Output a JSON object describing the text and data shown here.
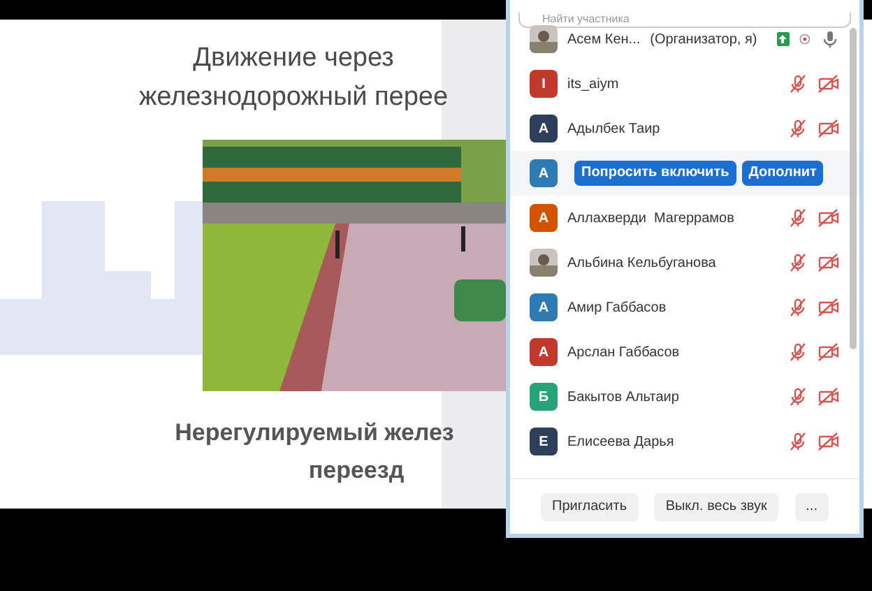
{
  "slide": {
    "title_lines": [
      "Движение через",
      "железнодорожный перее"
    ],
    "caption_lines": [
      "Нерегулируемый желез",
      "переезд"
    ]
  },
  "participants_panel": {
    "search": {
      "placeholder": "Найти участника"
    },
    "participants": [
      {
        "name": "Асем Кен...",
        "role": "(Организатор, я)",
        "sharing": true,
        "recording": true,
        "muted": false
      },
      {
        "kind": "letter",
        "initial": "I",
        "color": "#c0392b",
        "name": "its_aiym",
        "muted": true,
        "video_off": true
      },
      {
        "kind": "letter",
        "initial": "A",
        "color": "#2c3e5a",
        "name": "Адылбек Таир",
        "muted": true,
        "video_off": true
      },
      {
        "kind": "actions",
        "initial": "A",
        "color": "#2e7bb4",
        "actions": [
          "Попросить включить",
          "Дополнит"
        ]
      },
      {
        "kind": "letter",
        "initial": "A",
        "color": "#d35400",
        "name": "Аллахверди  Магеррамов",
        "muted": true,
        "video_off": true
      },
      {
        "name": "Альбина Кельбуганова",
        "muted": true,
        "video_off": true
      },
      {
        "kind": "letter",
        "initial": "A",
        "color": "#2e7bb4",
        "name": "Амир Габбасов",
        "muted": true,
        "video_off": true
      },
      {
        "kind": "letter",
        "initial": "A",
        "color": "#c0392b",
        "name": "Арслан Габбасов",
        "muted": true,
        "video_off": true
      },
      {
        "kind": "letter",
        "initial": "Б",
        "color": "#27a37a",
        "name": "Бакытов Альтаир",
        "muted": true,
        "video_off": true
      },
      {
        "kind": "letter",
        "initial": "E",
        "color": "#2c3e5a",
        "name": "Елисеева Дарья",
        "muted": true,
        "video_off": true
      }
    ],
    "footer_buttons": [
      "Пригласить",
      "Выкл. весь звук",
      "..."
    ]
  }
}
